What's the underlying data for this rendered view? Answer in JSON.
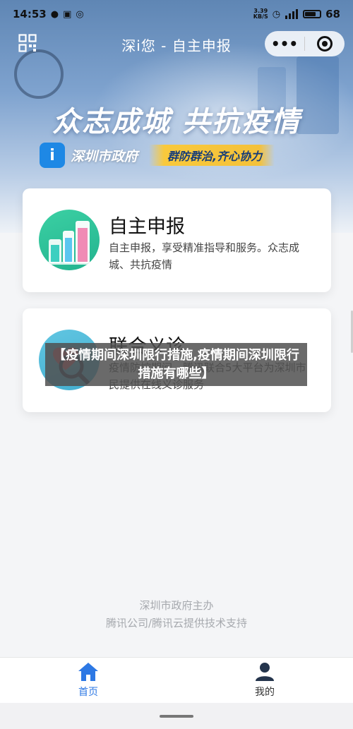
{
  "status_bar": {
    "time": "14:53",
    "net_speed_value": "3.39",
    "net_speed_unit": "KB/S",
    "battery": "68",
    "battery_level": 0.68
  },
  "nav": {
    "title": "深i您 - 自主申报"
  },
  "hero": {
    "slogan": "众志成城 共抗疫情",
    "gov_logo_text": "i",
    "gov_name": "深圳市政府",
    "tagline": "群防群治,齐心协力"
  },
  "cards": [
    {
      "title": "自主申报",
      "description": "自主申报，享受精准指导和服务。众志成城、共抗疫情"
    },
    {
      "title": "联合义诊",
      "description": "疫情防控期间，腾讯联合5大平台为深圳市民提供在线义诊服务"
    }
  ],
  "overlay": {
    "text": "【疫情期间深圳限行措施,疫情期间深圳限行措施有哪些】"
  },
  "footer": {
    "line1": "深圳市政府主办",
    "line2": "腾讯公司/腾讯云提供技术支持"
  },
  "tabs": [
    {
      "label": "首页",
      "active": true
    },
    {
      "label": "我的",
      "active": false
    }
  ],
  "colors": {
    "accent": "#2d78e4",
    "tagline_bg": "#f4c13a",
    "card_1_icon": "#23b38f",
    "card_2_icon": "#43aecf"
  }
}
